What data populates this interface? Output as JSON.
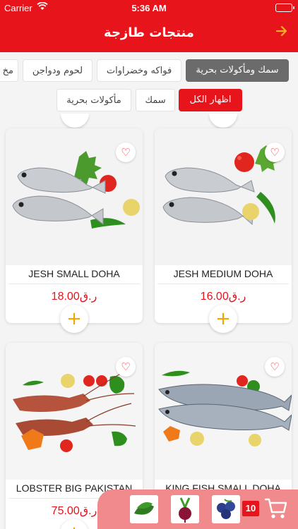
{
  "status_bar": {
    "carrier": "Carrier",
    "time": "5:36 AM"
  },
  "header": {
    "title": "منتجات طازجة",
    "back_icon": "arrow-icon"
  },
  "categories": [
    {
      "label": "سمك ومأكولات بحرية",
      "selected": true
    },
    {
      "label": "فواكه وخضراوات",
      "selected": false
    },
    {
      "label": "لحوم ودواجن",
      "selected": false
    },
    {
      "label": "مخ",
      "selected": false
    }
  ],
  "subcategories": [
    {
      "label": "اظهار الكل",
      "selected": true
    },
    {
      "label": "سمك",
      "selected": false
    },
    {
      "label": "مأكولات بحرية",
      "selected": false
    }
  ],
  "products": [
    {
      "name": "JESH MEDIUM DOHA",
      "price": "16.00ر.ق",
      "image": "jesh-medium-fish"
    },
    {
      "name": "JESH SMALL DOHA",
      "price": "18.00ر.ق",
      "image": "jesh-small-fish"
    },
    {
      "name": "KING FISH SMALL DOHA",
      "price": "",
      "image": "king-fish"
    },
    {
      "name": "LOBSTER BIG PAKISTAN",
      "price": "75.00ر.ق",
      "image": "lobster"
    }
  ],
  "cart": {
    "count": "10",
    "items": [
      "blueberries-thumb",
      "beetroot-thumb",
      "spinach-thumb"
    ],
    "icon": "cart-icon"
  },
  "colors": {
    "primary": "#e8141c",
    "accent": "#f0a500",
    "chip_dark": "#6b6b6b",
    "cart_bar": "#f08a8d"
  }
}
